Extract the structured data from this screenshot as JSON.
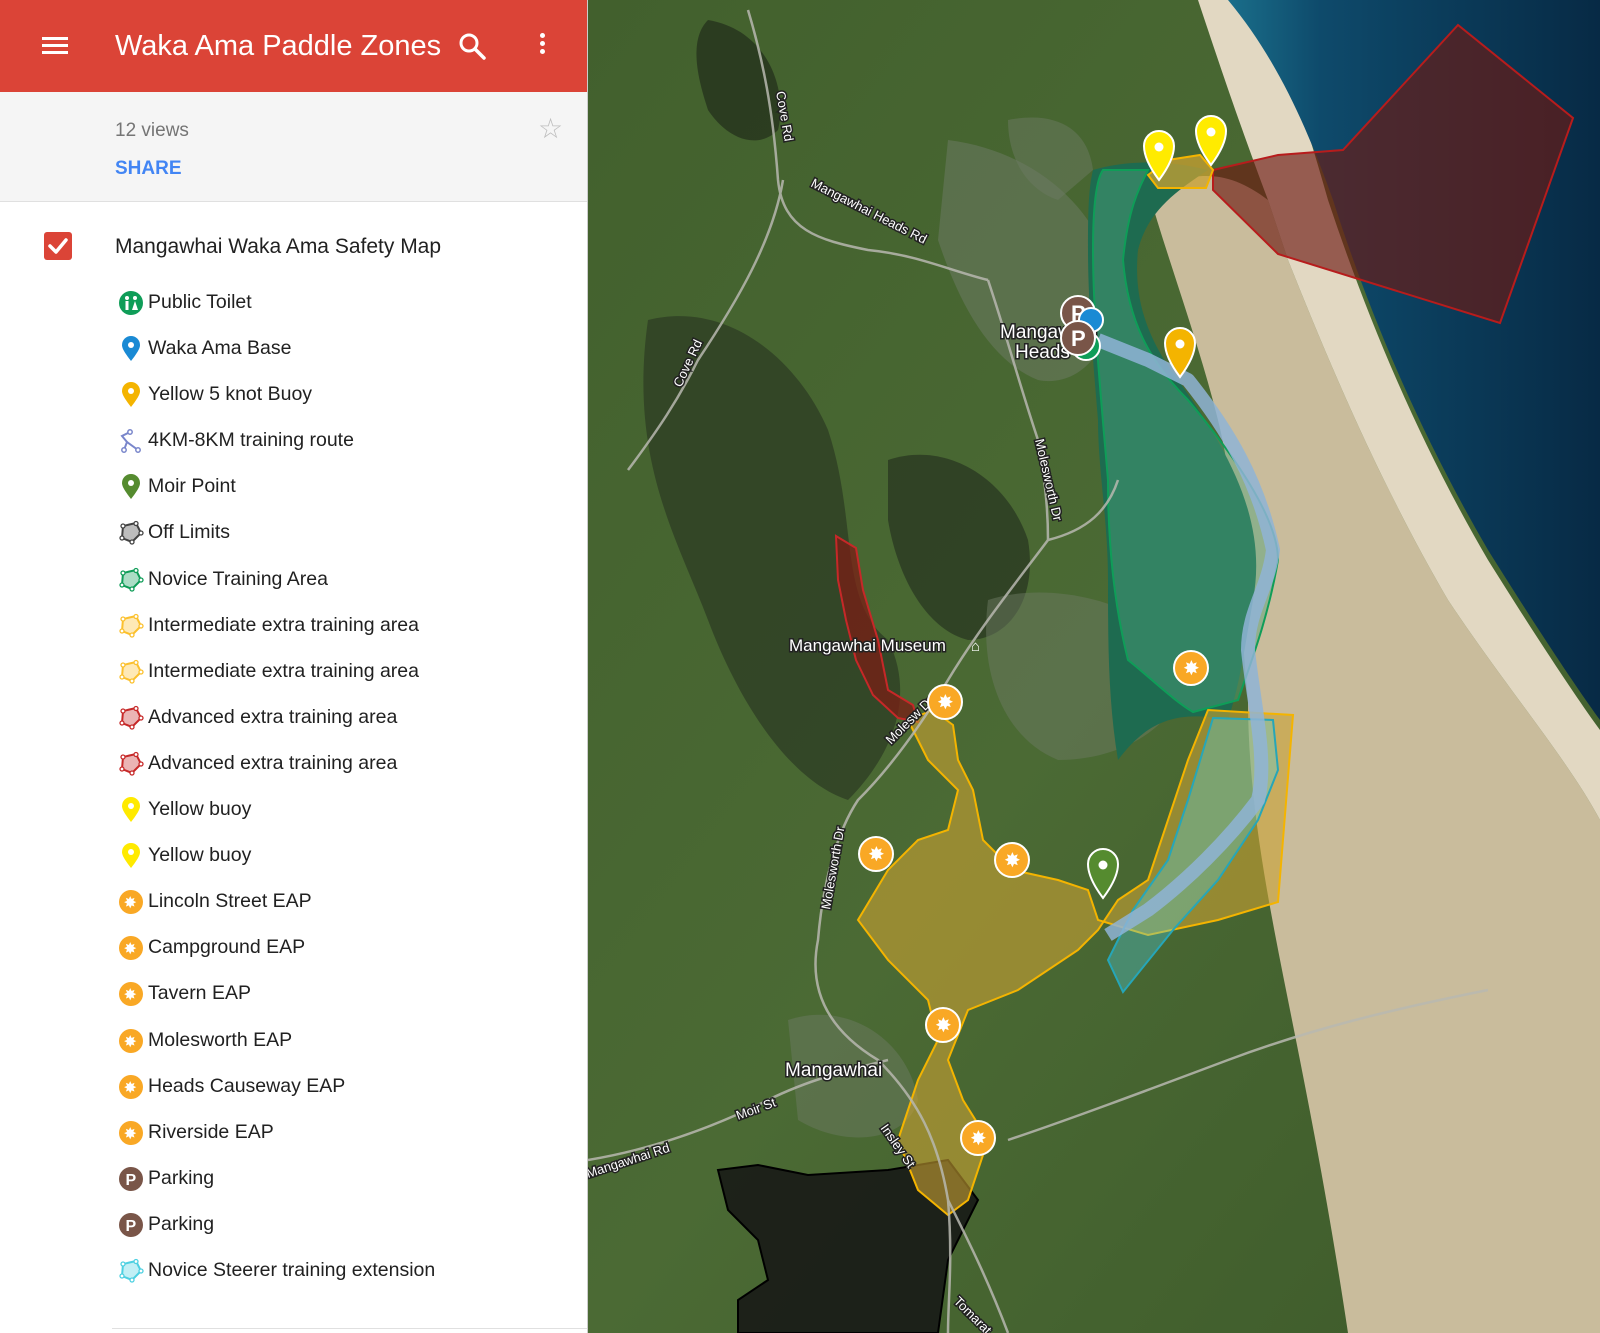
{
  "app": {
    "title": "Waka Ama Paddle Zones",
    "views": "12 views",
    "share_label": "SHARE"
  },
  "layer": {
    "title": "Mangawhai Waka Ama Safety Map",
    "checked": true
  },
  "legend": [
    {
      "label": "Public Toilet",
      "icon": "toilet-icon",
      "color": "#0f9d58"
    },
    {
      "label": "Waka Ama Base",
      "icon": "blue-pin-icon",
      "color": "#1a8ad4"
    },
    {
      "label": "Yellow 5 knot Buoy",
      "icon": "orange-pin-icon",
      "color": "#f4b400"
    },
    {
      "label": "4KM-8KM training route",
      "icon": "route-line-icon",
      "color": "#7986cb"
    },
    {
      "label": "Moir Point",
      "icon": "green-pin-icon",
      "color": "#558b2f"
    },
    {
      "label": "Off Limits",
      "icon": "polygon-icon",
      "color": "#424242"
    },
    {
      "label": "Novice Training Area",
      "icon": "polygon-icon",
      "color": "#0f9d58"
    },
    {
      "label": "Intermediate extra training area",
      "icon": "polygon-icon",
      "color": "#fbc02d"
    },
    {
      "label": "Intermediate extra training area",
      "icon": "polygon-icon",
      "color": "#fbc02d"
    },
    {
      "label": "Advanced extra training area",
      "icon": "polygon-icon",
      "color": "#c62828"
    },
    {
      "label": "Advanced extra training area",
      "icon": "polygon-icon",
      "color": "#c62828"
    },
    {
      "label": "Yellow buoy",
      "icon": "yellow-pin-icon",
      "color": "#ffea00"
    },
    {
      "label": "Yellow buoy",
      "icon": "yellow-pin-icon",
      "color": "#ffea00"
    },
    {
      "label": "Lincoln Street EAP",
      "icon": "eap-icon",
      "color": "#f9a825"
    },
    {
      "label": "Campground EAP",
      "icon": "eap-icon",
      "color": "#f9a825"
    },
    {
      "label": "Tavern EAP",
      "icon": "eap-icon",
      "color": "#f9a825"
    },
    {
      "label": "Molesworth EAP",
      "icon": "eap-icon",
      "color": "#f9a825"
    },
    {
      "label": "Heads Causeway EAP",
      "icon": "eap-icon",
      "color": "#f9a825"
    },
    {
      "label": "Riverside EAP",
      "icon": "eap-icon",
      "color": "#f9a825"
    },
    {
      "label": "Parking",
      "icon": "parking-icon",
      "color": "#795548"
    },
    {
      "label": "Parking",
      "icon": "parking-icon",
      "color": "#795548"
    },
    {
      "label": "Novice Steerer training extension",
      "icon": "polygon-icon",
      "color": "#4dd0e1"
    }
  ],
  "map": {
    "labels": {
      "heads_line1": "Mangawhai",
      "heads_line2": "Heads",
      "town": "Mangawhai",
      "museum": "Mangawhai Museum",
      "cove_rd_north": "Cove Rd",
      "cove_rd_south": "Cove Rd",
      "heads_rd": "Mangawhai Heads Rd",
      "molesworth_north": "Molesworth Dr",
      "molesworth_mid": "Molesw    Dr",
      "molesworth_south": "Molesworth Dr",
      "moir_st": "Moir St",
      "mangawhai_rd": "Mangawhai Rd",
      "insley_st": "Insley St",
      "tomarata": "Tomarat"
    },
    "colors": {
      "ocean": "#0b3552",
      "land": "#3f5a2c",
      "sand": "#cdbf9f",
      "estuary": "#2f7a5a",
      "yellow_zone": "#c9a233",
      "advanced_zone": "#8a2a1f",
      "off_limits": "#1e1e1e",
      "route": "#8fb4d6",
      "novice_zone": "#4ea27a"
    }
  }
}
